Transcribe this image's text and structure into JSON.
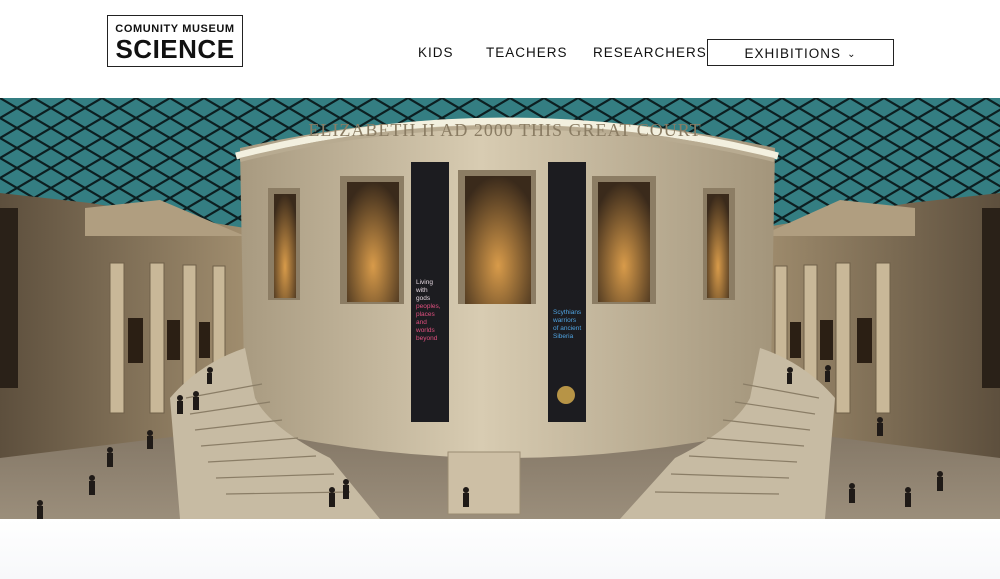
{
  "logo": {
    "top_text": "COMUNITY MUSEUM",
    "main_text": "SCIENCE"
  },
  "nav": {
    "items": [
      {
        "label": "KIDS"
      },
      {
        "label": "TEACHERS"
      },
      {
        "label": "RESEARCHERS"
      }
    ],
    "exhibitions": {
      "label": "EXHIBITIONS",
      "icon": "chevron-down-icon"
    }
  },
  "hero": {
    "inscription": "ELIZABETH II AD 2000 THIS GREAT COURT",
    "banner_left": [
      "Living",
      "with",
      "gods",
      "peoples,",
      "places",
      "and",
      "worlds",
      "beyond"
    ],
    "banner_right": [
      "Scythians",
      "warriors",
      "of ancient",
      "Siberia"
    ]
  },
  "colors": {
    "text": "#111111",
    "roof": "#3f8f93",
    "stone": "#cfc0a4"
  }
}
